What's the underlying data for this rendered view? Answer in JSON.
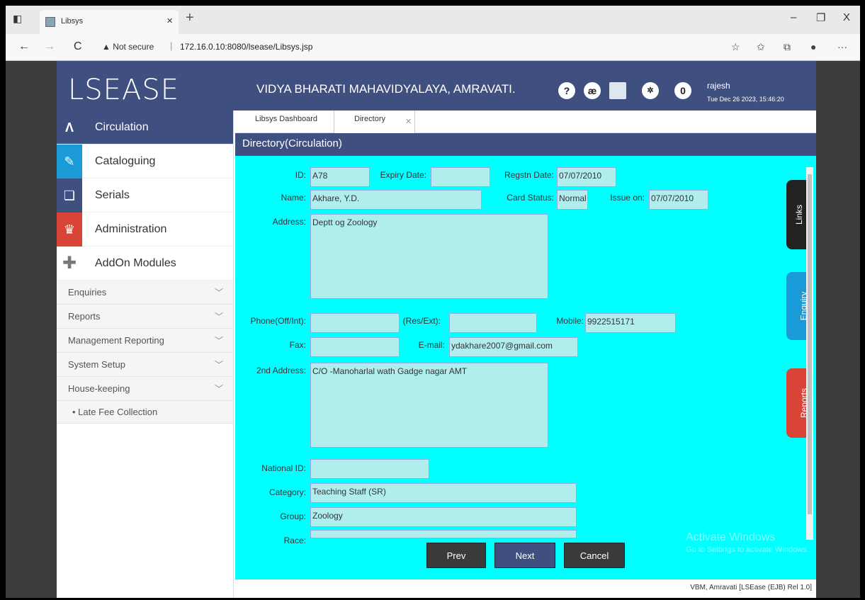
{
  "browser": {
    "tab_title": "Libsys",
    "tab_close": "×",
    "new_tab": "+",
    "security": "▲ Not secure",
    "url_sep": "|",
    "url": "172.16.0.10:8080/lsease/Libsys.jsp",
    "win_min": "–",
    "win_max": "❐",
    "win_close": "X",
    "back": "←",
    "forward": "→",
    "reload": "C",
    "more": "···"
  },
  "header": {
    "logo": "LSEASE",
    "college": "VIDYA BHARATI MAHAVIDYALAYA, AMRAVATI.",
    "help_icon": "?",
    "lang_icon": "æ",
    "count": "0",
    "user": "rajesh",
    "datetime": "Tue Dec 26 2023, 15:46:20"
  },
  "sidebar": {
    "modules": [
      {
        "label": "Circulation"
      },
      {
        "label": "Cataloguing"
      },
      {
        "label": "Serials"
      },
      {
        "label": "Administration"
      },
      {
        "label": "AddOn Modules"
      }
    ],
    "menus": [
      {
        "label": "Enquiries"
      },
      {
        "label": "Reports"
      },
      {
        "label": "Management Reporting"
      },
      {
        "label": "System Setup"
      },
      {
        "label": "House-keeping"
      }
    ],
    "subitems": [
      {
        "label": "• Late Fee Collection"
      }
    ]
  },
  "tabs": [
    {
      "label": "Libsys Dashboard"
    },
    {
      "label": "Directory"
    }
  ],
  "tab_close": "✕",
  "section_title": "Directory(Circulation)",
  "form": {
    "id_label": "ID:",
    "id": "A78",
    "expiry_label": "Expiry Date:",
    "expiry": "",
    "regstn_label": "Regstn Date:",
    "regstn": "07/07/2010",
    "name_label": "Name:",
    "name": "Akhare, Y.D.",
    "card_status_label": "Card Status:",
    "card_status": "Normal",
    "issue_on_label": "Issue on:",
    "issue_on": "07/07/2010",
    "address_label": "Address:",
    "address": "Deptt og Zoology",
    "phone_label": "Phone(Off/Int):",
    "phone": "",
    "res_label": "(Res/Ext):",
    "res": "",
    "mobile_label": "Mobile:",
    "mobile": "9922515171",
    "fax_label": "Fax:",
    "fax": "",
    "email_label": "E-mail:",
    "email": "ydakhare2007@gmail.com",
    "address2_label": "2nd Address:",
    "address2": "C/O -Manoharlal wath Gadge nagar AMT",
    "national_label": "National ID:",
    "national": "",
    "category_label": "Category:",
    "category": "Teaching Staff (SR)",
    "group_label": "Group:",
    "group": "Zoology",
    "race_label": "Race:",
    "race": ""
  },
  "sidetabs": {
    "links": "Links",
    "enquiry": "Enquiry",
    "reports": "Reports"
  },
  "buttons": {
    "prev": "Prev",
    "next": "Next",
    "cancel": "Cancel"
  },
  "watermark": {
    "line1": "Activate Windows",
    "line2": "Go to Settings to activate Windows."
  },
  "footer": "VBM, Amravati [LSEase (EJB) Rel 1.0]",
  "colors": {
    "header": "#3f4f7f",
    "form_bg": "#00ffff",
    "field_bg": "#b0eeee"
  }
}
